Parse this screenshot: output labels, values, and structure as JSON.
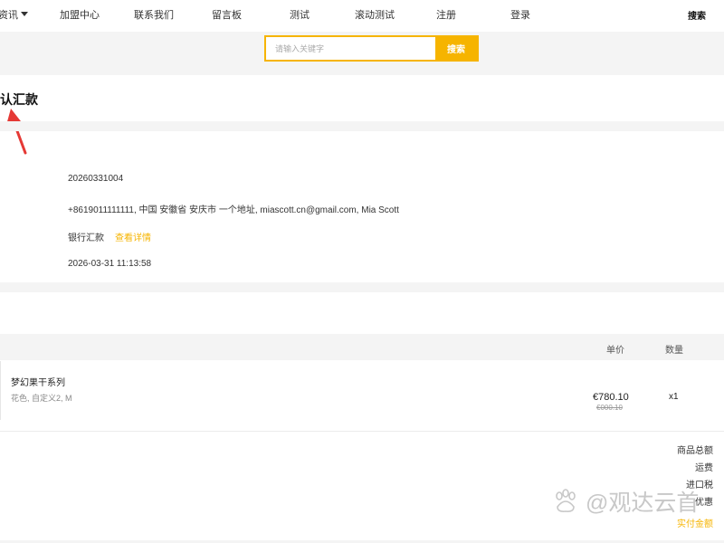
{
  "nav": {
    "items": [
      "资讯",
      "加盟中心",
      "联系我们",
      "留言板",
      "测试",
      "滚动测试",
      "注册",
      "登录"
    ],
    "search_label": "搜索"
  },
  "search": {
    "placeholder": "请输入关键字",
    "button_label": "搜索"
  },
  "page": {
    "title": "认汇款"
  },
  "order": {
    "number": "20260331004",
    "address": "+8619011111111, 中国 安徽省 安庆市 一个地址, miascott.cn@gmail.com, Mia Scott",
    "payment_method": "银行汇款",
    "view_detail_label": "查看详情",
    "time": "2026-03-31 11:13:58"
  },
  "products": {
    "headers": {
      "price": "单价",
      "quantity": "数量"
    },
    "rows": [
      {
        "name": "梦幻果干系列",
        "variant": "花色, 自定义2, M",
        "price": "€780.10",
        "original_price": "€000.10",
        "quantity": "x1"
      }
    ]
  },
  "summary": {
    "subtotal_label": "商品总额",
    "shipping_label": "运费",
    "import_tax_label": "进口税",
    "discount_label": "优惠",
    "total_label": "实付金额"
  },
  "watermark": {
    "text": "@观达云首"
  },
  "colors": {
    "accent": "#f6b400",
    "band": "#f4f4f4",
    "arrow": "#e53935"
  }
}
